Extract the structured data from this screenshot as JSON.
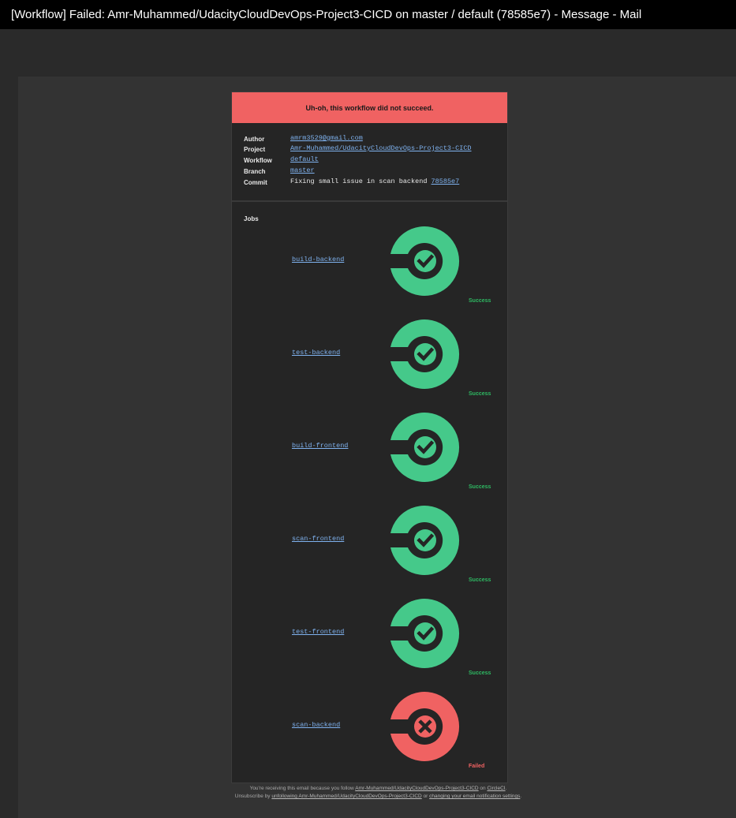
{
  "window": {
    "title": "[Workflow] Failed: Amr-Muhammed/UdacityCloudDevOps-Project3-CICD on master / default (78585e7) - Message - Mail"
  },
  "email": {
    "banner_text": "Uh-oh, this workflow did not succeed.",
    "details": {
      "author_label": "Author",
      "author_value": "amrm3529@gmail.com",
      "project_label": "Project",
      "project_value": "Amr-Muhammed/UdacityCloudDevOps-Project3-CICD",
      "workflow_label": "Workflow",
      "workflow_value": "default",
      "branch_label": "Branch",
      "branch_value": "master",
      "commit_label": "Commit",
      "commit_message": "Fixing small issue in scan backend",
      "commit_hash": "78585e7"
    },
    "jobs_heading": "Jobs",
    "jobs": [
      {
        "name": "build-backend",
        "status": "Success",
        "state": "success"
      },
      {
        "name": "test-backend",
        "status": "Success",
        "state": "success"
      },
      {
        "name": "build-frontend",
        "status": "Success",
        "state": "success"
      },
      {
        "name": "scan-frontend",
        "status": "Success",
        "state": "success"
      },
      {
        "name": "test-frontend",
        "status": "Success",
        "state": "success"
      },
      {
        "name": "scan-backend",
        "status": "Failed",
        "state": "failed"
      }
    ],
    "footer": {
      "line1_prefix": "You're receiving this email because you follow",
      "line1_link": "Amr-Muhammed/UdacityCloudDevOps-Project3-CICD",
      "line1_on": "on",
      "line1_circleci": "CircleCI",
      "line1_end": ".",
      "line2_prefix": "Unsubscribe by",
      "line2_link1": "unfollowing Amr-Muhammed/UdacityCloudDevOps-Project3-CICD",
      "line2_or": "or",
      "line2_link2": "changing your email notification settings",
      "line2_end": "."
    }
  },
  "colors": {
    "success": "#45c98a",
    "failed": "#f06262",
    "banner": "#f06262",
    "link": "#7fb2ef",
    "success_text": "#2eb862"
  },
  "icons": {
    "success": "check-circle-icon",
    "failed": "x-circle-icon"
  }
}
